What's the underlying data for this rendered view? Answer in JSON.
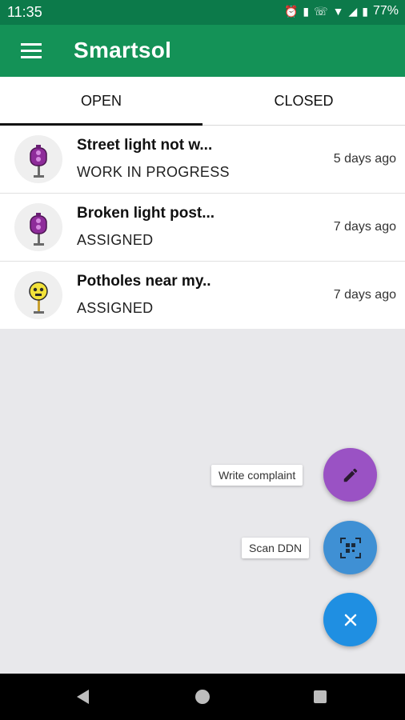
{
  "status_bar": {
    "time": "11:35",
    "battery": "77%",
    "icons": [
      "alarm-icon",
      "vibrate-icon",
      "lte-call-icon",
      "wifi-icon",
      "signal-icon",
      "battery-icon"
    ]
  },
  "app_bar": {
    "title": "Smartsol",
    "color": "#149257"
  },
  "tabs": [
    {
      "label": "OPEN",
      "selected": true
    },
    {
      "label": "CLOSED",
      "selected": false
    }
  ],
  "complaints": [
    {
      "title": "Street light not w...",
      "status": "WORK IN PROGRESS",
      "time": "5 days ago",
      "icon": "purple-streetlight-icon"
    },
    {
      "title": "Broken light post...",
      "status": "ASSIGNED",
      "time": "7 days ago",
      "icon": "purple-streetlight-icon"
    },
    {
      "title": "Potholes near my..",
      "status": "ASSIGNED",
      "time": "7 days ago",
      "icon": "yellow-streetlight-icon"
    }
  ],
  "fab_menu": {
    "write_label": "Write complaint",
    "scan_label": "Scan DDN",
    "write_color": "#9a52c4",
    "scan_color": "#3f90d4",
    "close_color": "#1f8fe2"
  }
}
